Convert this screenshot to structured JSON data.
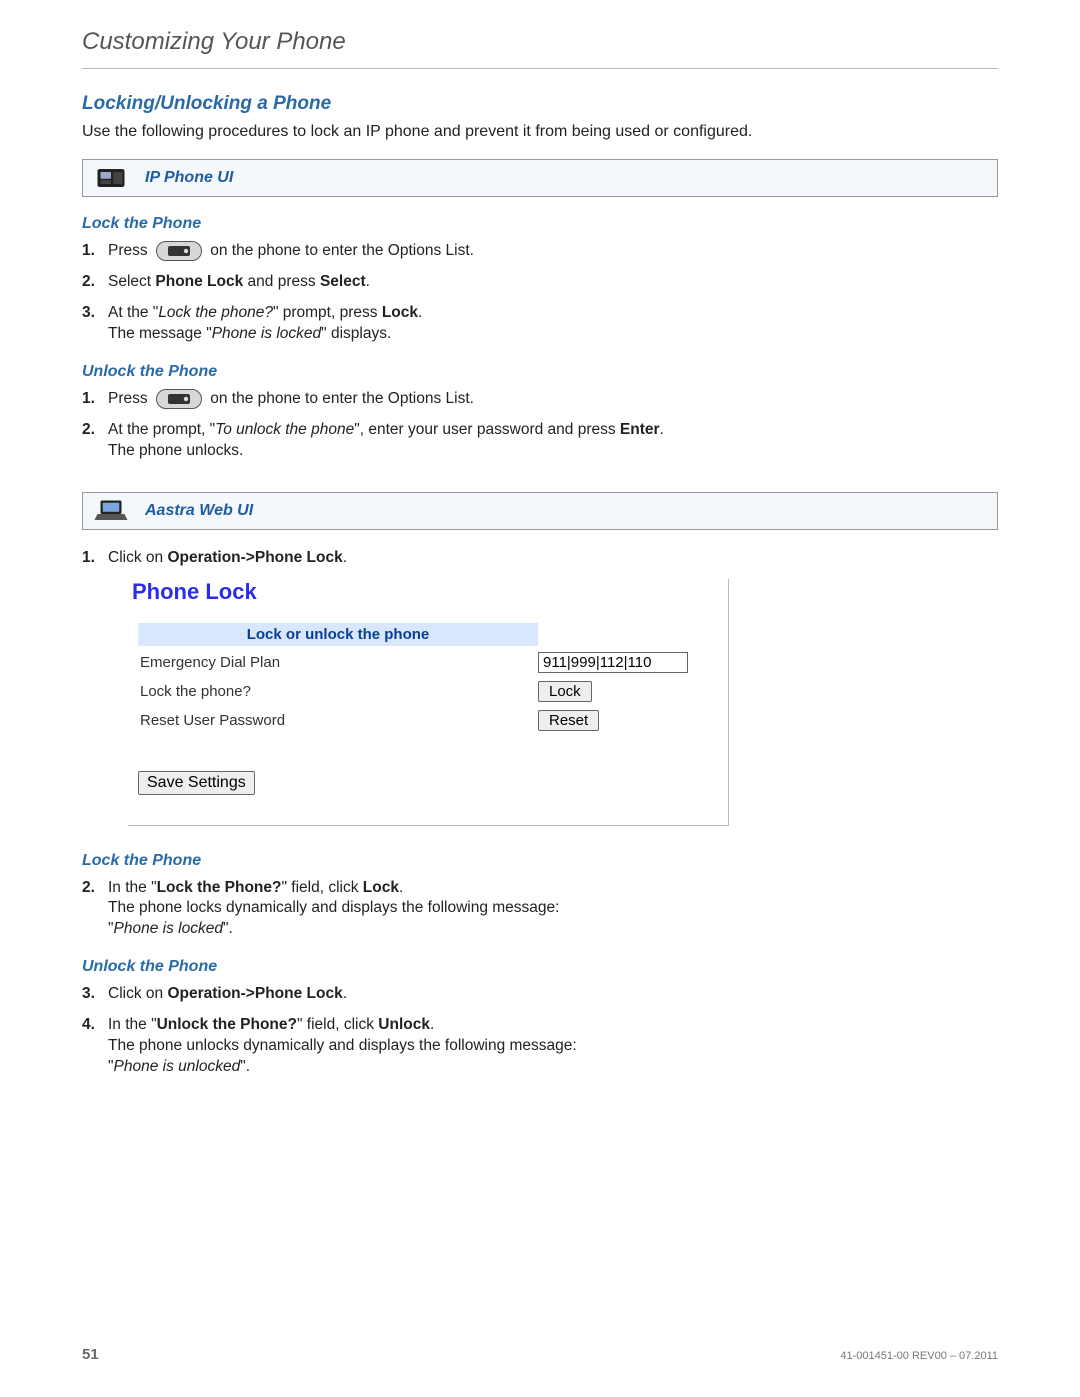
{
  "chapter": {
    "title": "Customizing Your Phone"
  },
  "section1": {
    "title": "Locking/Unlocking a Phone",
    "intro": "Use the following procedures to lock an IP phone and prevent it from being used or configured."
  },
  "callout_phone": {
    "title": "IP Phone UI"
  },
  "lock_phone_ui": {
    "title": "Lock the Phone",
    "steps": {
      "s1": {
        "num": "1.",
        "a": "Press",
        "b": "on the phone to enter the Options List."
      },
      "s2": {
        "num": "2.",
        "a": "Select ",
        "bold1": "Phone Lock",
        "b": " and press ",
        "bold2": "Select",
        "c": "."
      },
      "s3": {
        "num": "3.",
        "a": "At the \"",
        "ital1": "Lock the phone?",
        "b": "\" prompt, press ",
        "bold1": "Lock",
        "c": ".",
        "line2a": "The message \"",
        "ital2": "Phone is locked",
        "line2b": "\" displays."
      }
    }
  },
  "unlock_phone_ui": {
    "title": "Unlock the Phone",
    "steps": {
      "s1": {
        "num": "1.",
        "a": "Press",
        "b": "on the phone to enter the Options List."
      },
      "s2": {
        "num": "2.",
        "a": "At the prompt, \"",
        "ital1": "To unlock the phone",
        "b": "\", enter your user password and press ",
        "bold1": "Enter",
        "c": ".",
        "line2": "The phone unlocks."
      }
    }
  },
  "callout_web": {
    "title": "Aastra Web UI"
  },
  "web_step1": {
    "num": "1.",
    "a": "Click on ",
    "bold1": "Operation->Phone Lock",
    "b": "."
  },
  "webui": {
    "title": "Phone Lock",
    "header": "Lock or unlock the phone",
    "row1_label": "Emergency Dial Plan",
    "row1_value": "911|999|112|110",
    "row2_label": "Lock the phone?",
    "row2_btn": "Lock",
    "row3_label": "Reset User Password",
    "row3_btn": "Reset",
    "save_btn": "Save Settings"
  },
  "lock_phone_web": {
    "title": "Lock the Phone",
    "s2": {
      "num": "2.",
      "a": "In the \"",
      "bold1": "Lock the Phone?",
      "b": "\" field, click ",
      "bold2": "Lock",
      "c": ".",
      "line2": "The phone locks dynamically and displays the following message:",
      "line3a": "\"",
      "ital1": "Phone is locked",
      "line3b": "\"."
    }
  },
  "unlock_phone_web": {
    "title": "Unlock the Phone",
    "s3": {
      "num": "3.",
      "a": "Click on ",
      "bold1": "Operation->Phone Lock",
      "b": "."
    },
    "s4": {
      "num": "4.",
      "a": "In the \"",
      "bold1": "Unlock the Phone?",
      "b": "\" field, click ",
      "bold2": "Unlock",
      "c": ".",
      "line2": "The phone unlocks dynamically and displays the following message:",
      "line3a": "\"",
      "ital1": "Phone is unlocked",
      "line3b": "\"."
    }
  },
  "footer": {
    "page": "51",
    "rev": "41-001451-00 REV00 – 07.2011"
  }
}
